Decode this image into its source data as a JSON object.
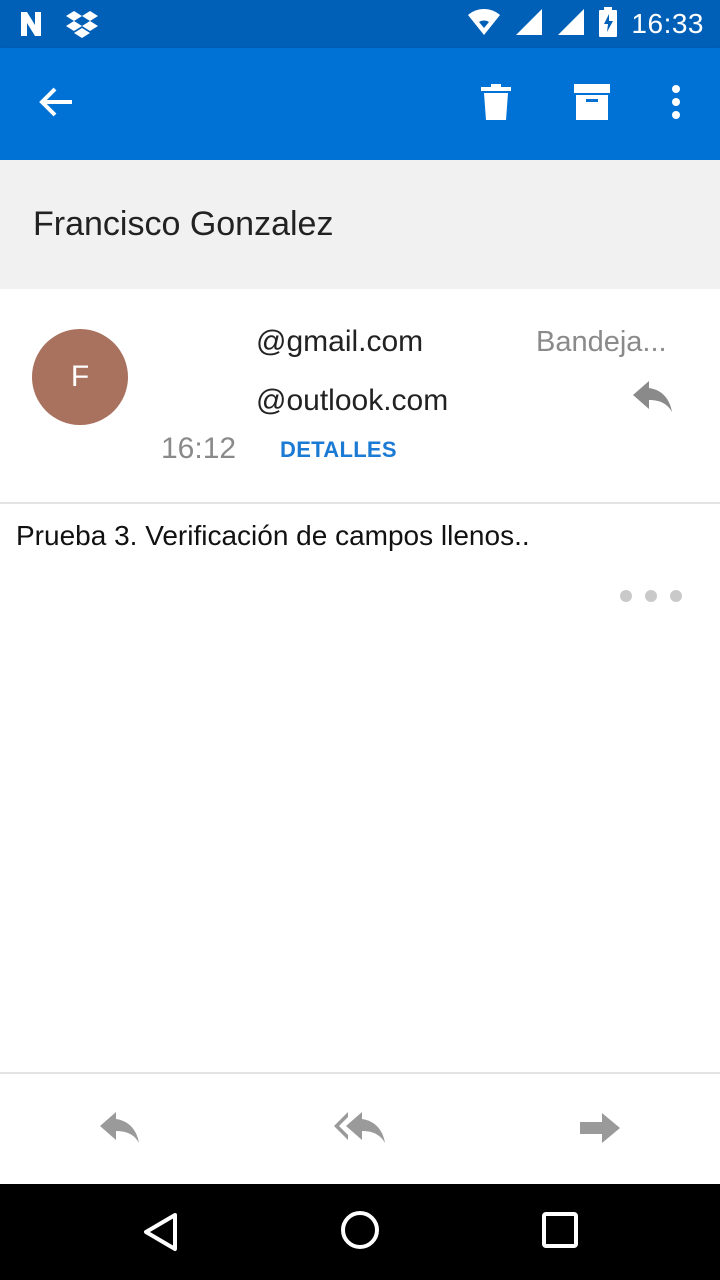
{
  "status_bar": {
    "time": "16:33",
    "icons": [
      "n-notification-icon",
      "dropbox-icon",
      "wifi-icon",
      "signal-icon",
      "signal-icon",
      "battery-charging-icon"
    ]
  },
  "app_bar": {
    "back_icon": "arrow-back-icon",
    "delete_icon": "trash-icon",
    "archive_icon": "archive-icon",
    "more_icon": "more-vert-icon",
    "color": "#0072d6"
  },
  "subject": {
    "title": "Francisco Gonzalez"
  },
  "message_header": {
    "avatar_letter": "F",
    "avatar_color": "#a8725f",
    "from": "@gmail.com",
    "to": "@outlook.com",
    "folder": "Bandeja...",
    "time": "16:12",
    "details_label": "DETALLES",
    "details_color": "#1a7ad4"
  },
  "message_body": {
    "text": "Prueba 3. Verificación de campos llenos.."
  },
  "bottom_actions": {
    "icons": [
      "reply-icon",
      "reply-all-icon",
      "forward-icon"
    ]
  },
  "nav_bar": {
    "icons": [
      "back-triangle-icon",
      "home-circle-icon",
      "recents-square-icon"
    ]
  }
}
